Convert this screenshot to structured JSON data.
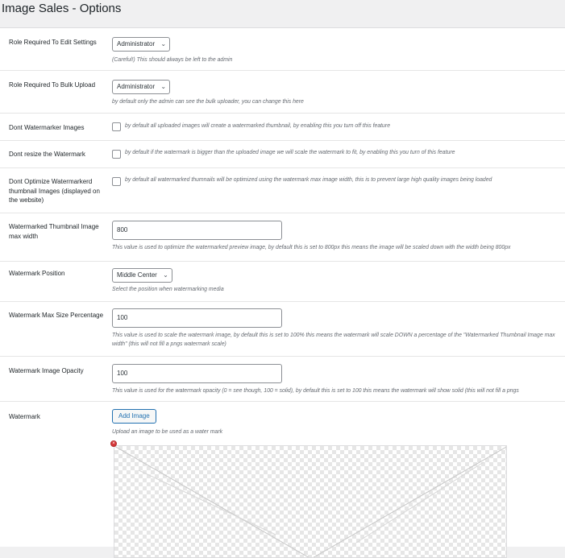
{
  "page": {
    "title": "Image Sales - Options"
  },
  "settings": {
    "role_edit": {
      "label": "Role Required To Edit Settings",
      "value": "Administrator",
      "desc": "(Careful!) This should always be left to the admin"
    },
    "role_bulk": {
      "label": "Role Required To Bulk Upload",
      "value": "Administrator",
      "desc": "by default only the admin can see the bulk uploader, you can change this here"
    },
    "no_watermark": {
      "label": "Dont Watermarker Images",
      "checked": false,
      "desc": "by default all uploaded images will create a watermarked thumbnail, by enabling this you turn off this feature"
    },
    "no_resize": {
      "label": "Dont resize the Watermark",
      "checked": false,
      "desc": "by default if the watermark is bigger than the uploaded image we will scale the watermark to fit, by enabling this you turn of this feature"
    },
    "no_optimize": {
      "label": "Dont Optimize Watermarkerd thumbnail Images (displayed on the website)",
      "checked": false,
      "desc": "by default all watermarked thumnails will be optimized using the watermark max image width, this is to prevent large high quality images being loaded"
    },
    "thumb_width": {
      "label": "Watermarked Thumbnail Image max width",
      "value": "800",
      "desc": "This value is used to optimize the watermarked preview image, by default this is set to 800px this means the image will be scaled down with the width being 800px"
    },
    "position": {
      "label": "Watermark Position",
      "value": "Middle Center",
      "desc": "Select the position when watermarking media"
    },
    "max_size": {
      "label": "Watermark Max Size Percentage",
      "value": "100",
      "desc": "This value is used to scale the watermark image, by default this is set to 100% this means the watermark will scale DOWN a percentage of the \"Watermarked Thumbnail Image max width\" (this will not fill a pngs watermark scale)"
    },
    "opacity": {
      "label": "Watermark Image Opacity",
      "value": "100",
      "desc": "This value is used for the watermark opacity (0 = see though, 100 = solid), by default this is set to 100 this means the watermark will show solid (this will not fill a pngs"
    },
    "watermark": {
      "label": "Watermark",
      "button": "Add Image",
      "desc": "Upload an image to be used as a water mark"
    }
  },
  "icons": {
    "dropdown": "chevron-down-icon",
    "remove": "remove-icon"
  },
  "colors": {
    "accent": "#2271b1",
    "remove": "#d63638"
  }
}
